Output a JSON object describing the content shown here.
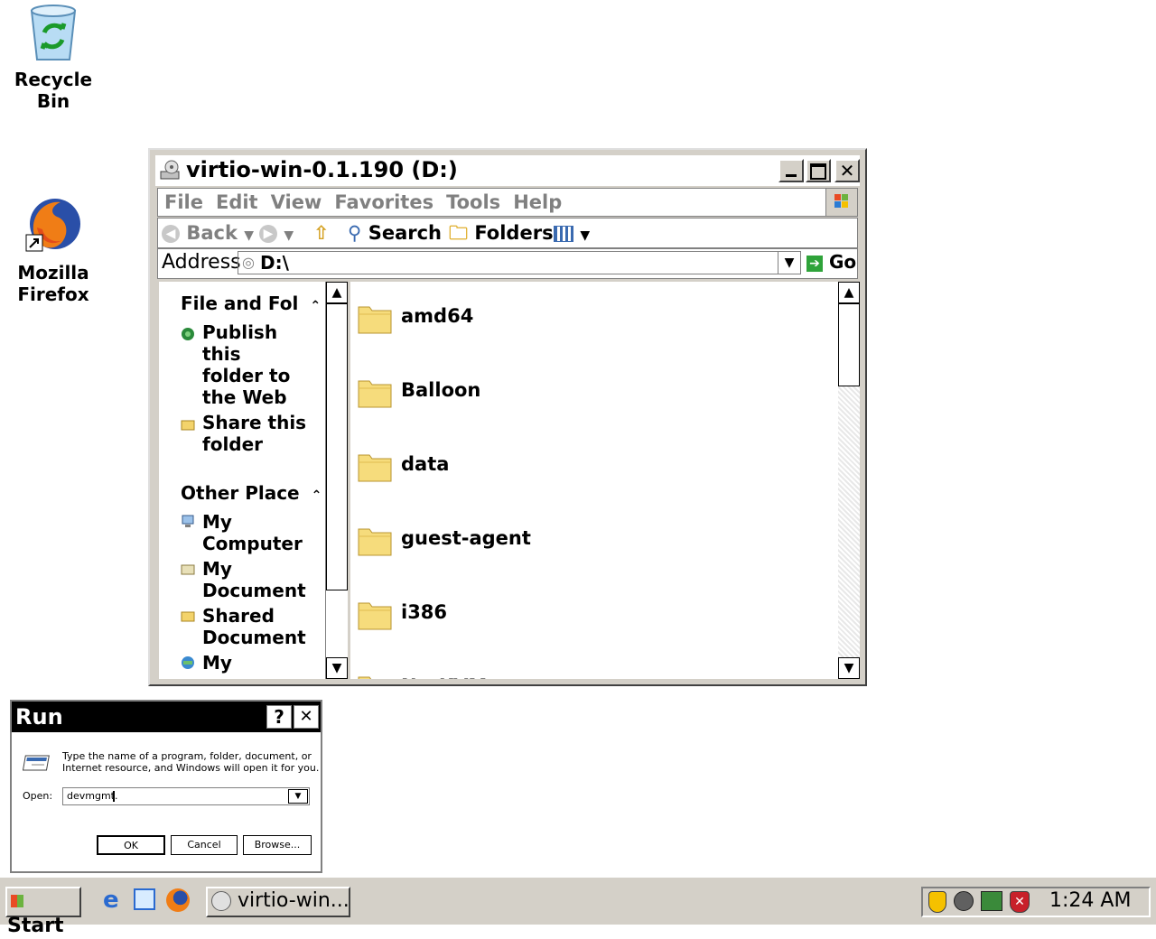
{
  "desktop": {
    "icons": [
      {
        "label_line1": "Recycle",
        "label_line2": "Bin"
      },
      {
        "label_line1": "Mozilla",
        "label_line2": "Firefox"
      }
    ]
  },
  "explorer": {
    "title": "virtio-win-0.1.190 (D:)",
    "menu": [
      "File",
      "Edit",
      "View",
      "Favorites",
      "Tools",
      "Help"
    ],
    "toolbar": {
      "back": "Back",
      "search": "Search",
      "folders": "Folders"
    },
    "address": {
      "label": "Address",
      "value": "D:\\",
      "go": "Go"
    },
    "tasks": {
      "file_folder_heading": "File and Fol",
      "publish": [
        "Publish",
        "this",
        "folder to",
        "the Web"
      ],
      "share": [
        "Share this",
        "folder"
      ],
      "other_heading": "Other Place",
      "places": [
        [
          "My",
          "Computer"
        ],
        [
          "My",
          "Document"
        ],
        [
          "Shared",
          "Document"
        ],
        [
          "My",
          ""
        ]
      ]
    },
    "folders": [
      "amd64",
      "Balloon",
      "data",
      "guest-agent",
      "i386",
      "NetKVM"
    ]
  },
  "run": {
    "title": "Run",
    "help_btn": "?",
    "close_btn": "✕",
    "description_line1": "Type the name of a program, folder, document, or",
    "description_line2": "Internet resource, and Windows will open it for you.",
    "open_label": "Open:",
    "open_value": "devmgmt.",
    "ok": "OK",
    "cancel": "Cancel",
    "browse": "Browse..."
  },
  "taskbar": {
    "start": "Start",
    "task_button": "virtio-win...",
    "clock": "1:24 AM"
  }
}
